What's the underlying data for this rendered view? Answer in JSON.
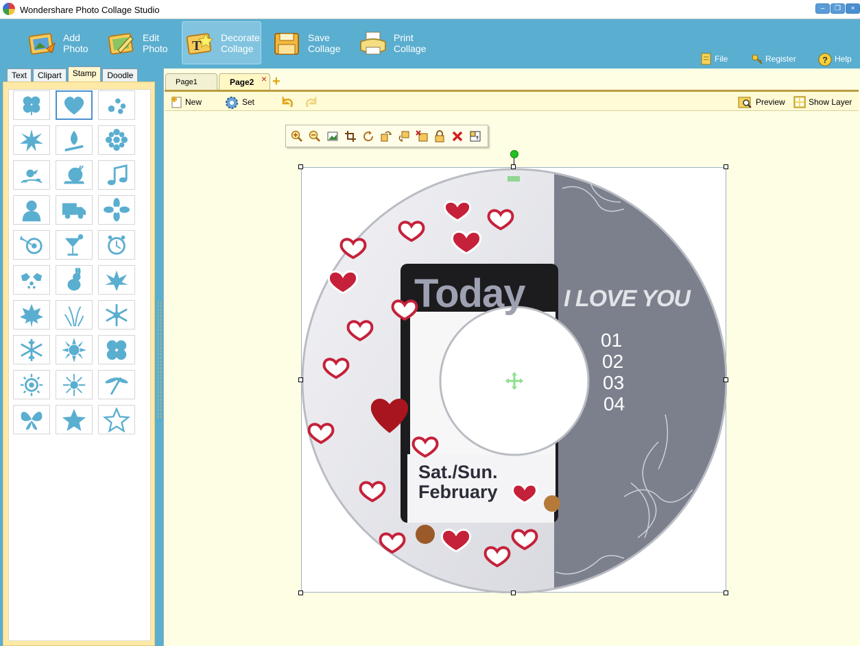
{
  "window": {
    "title": "Wondershare Photo Collage Studio",
    "minimize": "–",
    "restore": "❐",
    "close": "×"
  },
  "toolbar": {
    "add_photo": "Add\nPhoto",
    "edit_photo": "Edit\nPhoto",
    "decorate_collage": "Decorate\nCollage",
    "save_collage": "Save\nCollage",
    "print_collage": "Print\nCollage",
    "file": "File",
    "register": "Register",
    "help": "Help"
  },
  "left_tabs": [
    {
      "label": "Text"
    },
    {
      "label": "Clipart"
    },
    {
      "label": "Stamp",
      "active": true
    },
    {
      "label": "Doodle"
    }
  ],
  "stamps": [
    "clover",
    "heart",
    "paw",
    "starburst",
    "campfire",
    "flower-ring",
    "bird-branch",
    "snail",
    "music-note",
    "person",
    "truck",
    "daisy",
    "target",
    "cocktail",
    "alarm-clock",
    "holly",
    "rabbit",
    "leaf",
    "maple-leaf",
    "grass",
    "snowflake",
    "snowflake-2",
    "sunburst",
    "shamrock",
    "sun-swirl",
    "sun",
    "dragonfly",
    "butterfly",
    "star",
    "star-outline"
  ],
  "selected_stamp": "heart",
  "stamp_color": "#5aaed0",
  "page_tabs": [
    {
      "label": "Page1"
    },
    {
      "label": "Page2",
      "active": true
    }
  ],
  "page_close": "×",
  "add_page": "+",
  "sub_toolbar": {
    "new": "New",
    "set": "Set",
    "preview": "Preview",
    "show_layer": "Show Layer"
  },
  "float_toolbar": [
    "zoom-in",
    "zoom-out",
    "fit-image",
    "crop",
    "rotate",
    "flip-horizontal",
    "flip-vertical",
    "replace",
    "lock",
    "delete",
    "layer"
  ],
  "cd": {
    "photo_text_top": "Today",
    "photo_text_bottom_1": "Sat./Sun.",
    "photo_text_bottom_2": "February",
    "headline": "I LOVE YOU",
    "tracks": [
      "01",
      "02",
      "03",
      "04"
    ],
    "right_color": "#7b808c"
  }
}
